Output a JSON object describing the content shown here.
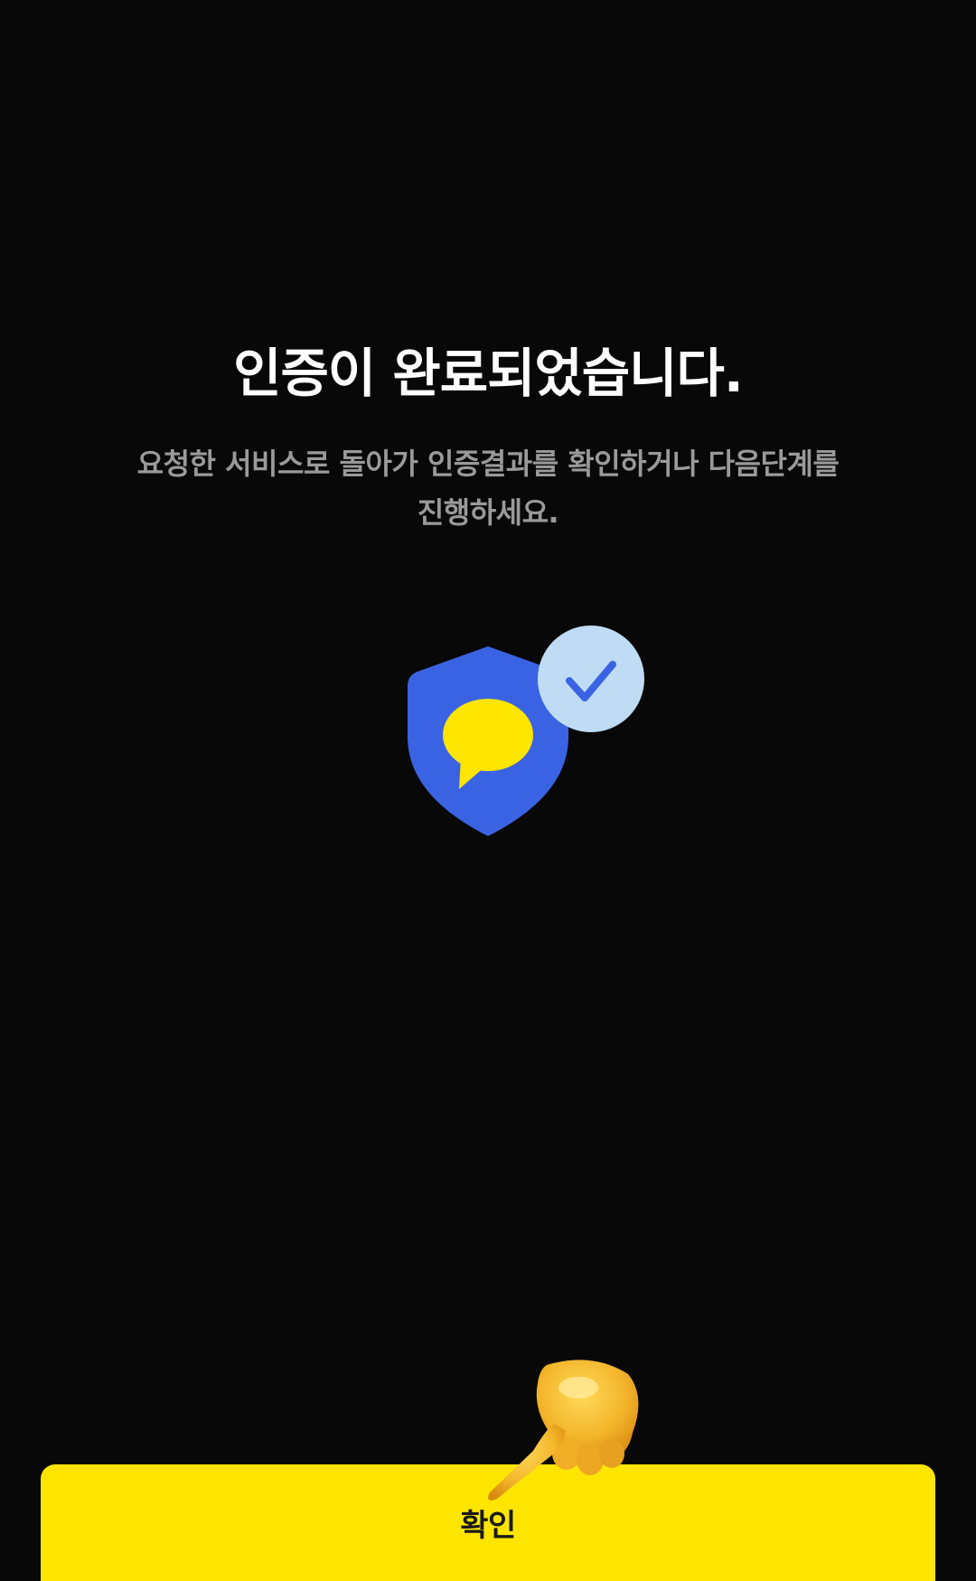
{
  "completion": {
    "title": "인증이 완료되었습니다.",
    "message_line1": "요청한 서비스로 돌아가 인증결과를 확인하거나 다음단계를",
    "message_line2": "진행하세요."
  },
  "illustration": {
    "shield_icon": "shield-chat-icon",
    "check_icon": "check-badge-icon"
  },
  "actions": {
    "confirm_label": "확인"
  },
  "colors": {
    "background": "#080808",
    "accent_yellow": "#fee500",
    "shield_blue": "#3a63e4",
    "badge_light_blue": "#bfdcf4"
  }
}
